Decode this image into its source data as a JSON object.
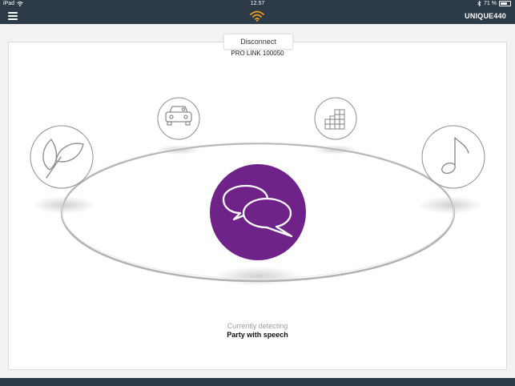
{
  "status_bar": {
    "carrier": "iPad",
    "time": "12.57",
    "battery_text": "71 %",
    "battery_level": 0.71
  },
  "app_bar": {
    "menu_icon": "hamburger-icon",
    "logo_icon": "wireless-signal-icon",
    "device_name": "UNIQUE440"
  },
  "connection": {
    "disconnect_label": "Disconnect",
    "device_id": "PRO LINK 100050"
  },
  "programs": [
    {
      "icon": "leaf-icon"
    },
    {
      "icon": "car-icon"
    },
    {
      "icon": "building-icon"
    },
    {
      "icon": "music-note-icon"
    },
    {
      "icon": "speech-bubbles-icon",
      "active": true
    }
  ],
  "detection": {
    "label": "Currently detecting",
    "value": "Party with speech"
  },
  "colors": {
    "bar": "#2d3a48",
    "active": "#6f2389",
    "logo": "#f0a020",
    "icon_stroke": "#8c8f93"
  }
}
